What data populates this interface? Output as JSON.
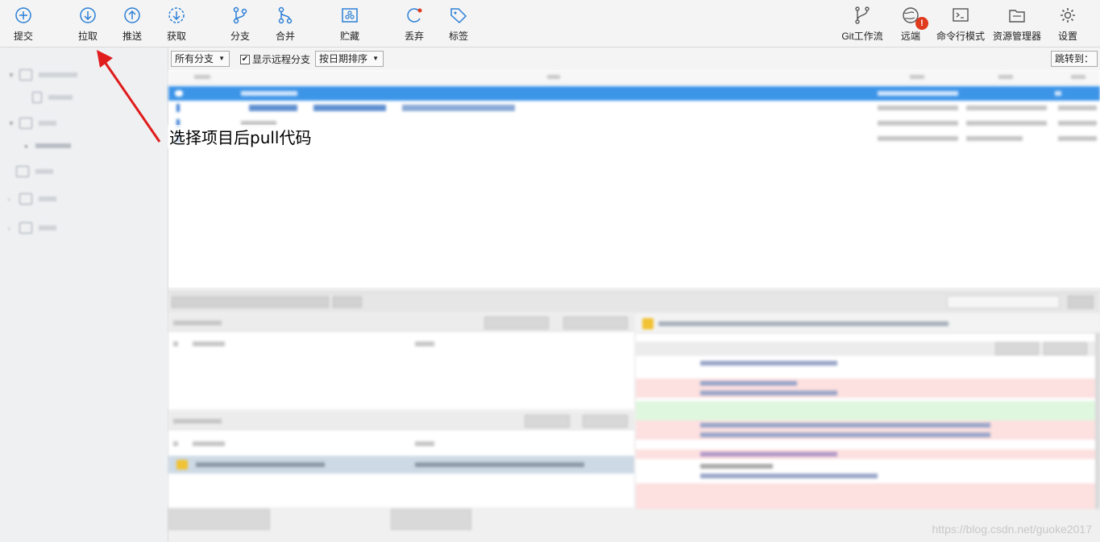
{
  "toolbar": {
    "commit": "提交",
    "pull": "拉取",
    "push": "推送",
    "fetch": "获取",
    "branch": "分支",
    "merge": "合并",
    "stash": "贮藏",
    "discard": "丢弃",
    "tag": "标签",
    "git_flow": "Git工作流",
    "remote": "远端",
    "remote_badge": "!",
    "terminal": "命令行模式",
    "explorer": "资源管理器",
    "settings": "设置"
  },
  "filters": {
    "branches": "所有分支",
    "show_remote": "显示远程分支",
    "sort": "按日期排序",
    "jump_to": "跳转到："
  },
  "annotation": {
    "text": "选择项目后pull代码",
    "arrow_color": "#e01c1c"
  },
  "watermark": "https://blog.csdn.net/guoke2017",
  "colors": {
    "selection": "#3d95e8",
    "accent": "#2b7fd6",
    "diff_removed": "#fde0e0",
    "diff_added": "#dff7df"
  }
}
